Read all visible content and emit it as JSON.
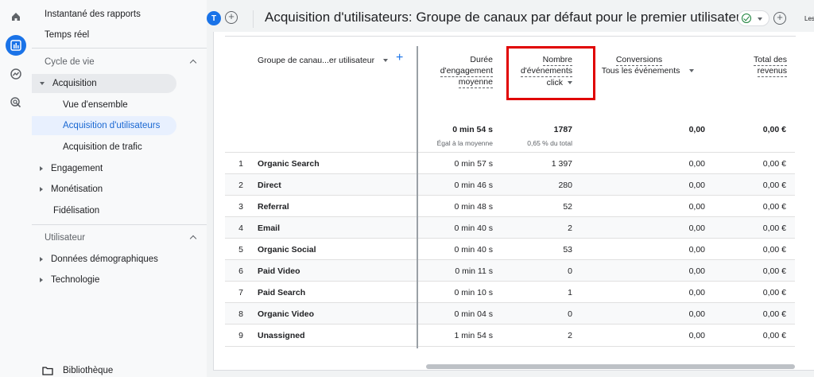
{
  "nav": {
    "items": [
      {
        "label": "Instantané des rapports"
      },
      {
        "label": "Temps réel"
      },
      {
        "label": "Cycle de vie"
      },
      {
        "label": "Acquisition"
      },
      {
        "label": "Vue d'ensemble"
      },
      {
        "label": "Acquisition d'utilisateurs"
      },
      {
        "label": "Acquisition de trafic"
      },
      {
        "label": "Engagement"
      },
      {
        "label": "Monétisation"
      },
      {
        "label": "Fidélisation"
      },
      {
        "label": "Utilisateur"
      },
      {
        "label": "Données démographiques"
      },
      {
        "label": "Technologie"
      }
    ],
    "library": "Bibliothèque"
  },
  "header": {
    "avatar": "T",
    "title": "Acquisition d'utilisateurs: Groupe de canaux par défaut pour le premier utilisateur",
    "right_text": "Les"
  },
  "table": {
    "dimension_header": "Groupe de canau...er utilisateur",
    "col_duration": [
      "Durée",
      "d'engagement",
      "moyenne"
    ],
    "col_events": [
      "Nombre",
      "d'événements"
    ],
    "col_events_filter": "click",
    "col_conversions": "Conversions",
    "col_conversions_filter": "Tous les événements",
    "col_revenue": [
      "Total des",
      "revenus"
    ],
    "totals": {
      "duration": "0 min 54 s",
      "duration_sub": "Égal à la moyenne",
      "events": "1787",
      "events_sub": "0,65 % du total",
      "conversions": "0,00",
      "revenue": "0,00 €"
    },
    "rows": [
      {
        "n": "1",
        "name": "Organic Search",
        "duration": "0 min 57 s",
        "events": "1 397",
        "conversions": "0,00",
        "revenue": "0,00 €"
      },
      {
        "n": "2",
        "name": "Direct",
        "duration": "0 min 46 s",
        "events": "280",
        "conversions": "0,00",
        "revenue": "0,00 €"
      },
      {
        "n": "3",
        "name": "Referral",
        "duration": "0 min 48 s",
        "events": "52",
        "conversions": "0,00",
        "revenue": "0,00 €"
      },
      {
        "n": "4",
        "name": "Email",
        "duration": "0 min 40 s",
        "events": "2",
        "conversions": "0,00",
        "revenue": "0,00 €"
      },
      {
        "n": "5",
        "name": "Organic Social",
        "duration": "0 min 40 s",
        "events": "53",
        "conversions": "0,00",
        "revenue": "0,00 €"
      },
      {
        "n": "6",
        "name": "Paid Video",
        "duration": "0 min 11 s",
        "events": "0",
        "conversions": "0,00",
        "revenue": "0,00 €"
      },
      {
        "n": "7",
        "name": "Paid Search",
        "duration": "0 min 10 s",
        "events": "1",
        "conversions": "0,00",
        "revenue": "0,00 €"
      },
      {
        "n": "8",
        "name": "Organic Video",
        "duration": "0 min 04 s",
        "events": "0",
        "conversions": "0,00",
        "revenue": "0,00 €"
      },
      {
        "n": "9",
        "name": "Unassigned",
        "duration": "1 min 54 s",
        "events": "2",
        "conversions": "0,00",
        "revenue": "0,00 €"
      }
    ]
  },
  "colors": {
    "accent": "#1a73e8",
    "highlight": "#e00000"
  }
}
